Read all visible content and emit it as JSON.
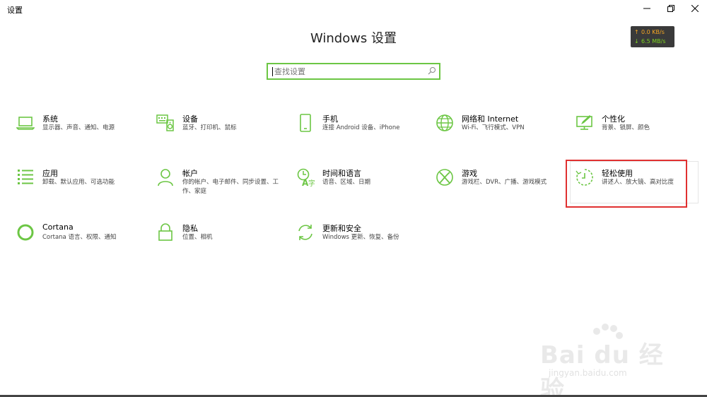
{
  "window": {
    "title": "设置"
  },
  "netspeed": {
    "up": "0.0 KB/s",
    "down": "6.5 MB/s",
    "up_color": "#f5a623",
    "down_color": "#7ed321"
  },
  "page": {
    "title": "Windows 设置"
  },
  "search": {
    "placeholder": "查找设置"
  },
  "accent_color": "#6cc644",
  "highlight_color": "#e03030",
  "items": [
    {
      "title": "系统",
      "desc": "显示器、声音、通知、电源",
      "icon": "laptop-icon"
    },
    {
      "title": "设备",
      "desc": "蓝牙、打印机、鼠标",
      "icon": "keyboard-speaker-icon"
    },
    {
      "title": "手机",
      "desc": "连接 Android 设备、iPhone",
      "icon": "phone-icon"
    },
    {
      "title": "网络和 Internet",
      "desc": "Wi-Fi、飞行模式、VPN",
      "icon": "globe-icon"
    },
    {
      "title": "个性化",
      "desc": "背景、锁屏、颜色",
      "icon": "monitor-pen-icon"
    },
    {
      "title": "应用",
      "desc": "卸载、默认应用、可选功能",
      "icon": "app-list-icon"
    },
    {
      "title": "帐户",
      "desc": "你的帐户、电子邮件、同步设置、工作、家庭",
      "icon": "person-icon"
    },
    {
      "title": "时间和语言",
      "desc": "语音、区域、日期",
      "icon": "clock-language-icon"
    },
    {
      "title": "游戏",
      "desc": "游戏栏、DVR、广播、游戏模式",
      "icon": "xbox-icon"
    },
    {
      "title": "轻松使用",
      "desc": "讲述人、放大镜、高对比度",
      "icon": "ease-of-access-icon"
    },
    {
      "title": "Cortana",
      "desc": "Cortana 语言、权限、通知",
      "icon": "cortana-icon"
    },
    {
      "title": "隐私",
      "desc": "位置、相机",
      "icon": "lock-icon"
    },
    {
      "title": "更新和安全",
      "desc": "Windows 更新、恢复、备份",
      "icon": "sync-icon"
    }
  ],
  "watermark": {
    "brand": "Bai du 经验",
    "url": "jingyan.baidu.com"
  }
}
